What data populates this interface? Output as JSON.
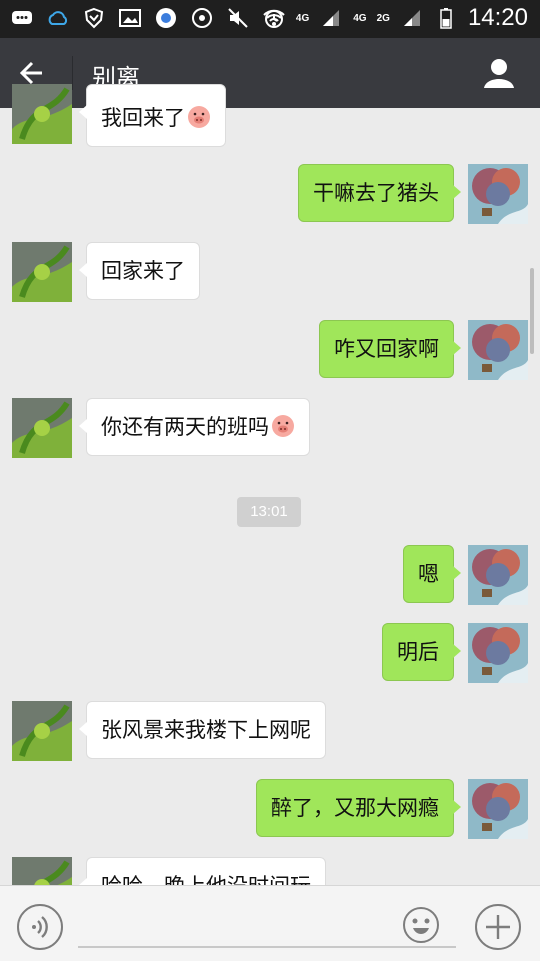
{
  "status_bar": {
    "time": "14:20",
    "network_1": "4G",
    "network_2": "4G",
    "network_3": "2G"
  },
  "header": {
    "title": "别离"
  },
  "messages": [
    {
      "side": "in",
      "text": "我回来了",
      "emoji": "pig-emoji"
    },
    {
      "side": "out",
      "text": "干嘛去了猪头"
    },
    {
      "side": "in",
      "text": "回家来了"
    },
    {
      "side": "out",
      "text": "咋又回家啊"
    },
    {
      "side": "in",
      "text": "你还有两天的班吗",
      "emoji": "pig-emoji"
    },
    {
      "side": "out",
      "text": "嗯"
    },
    {
      "side": "out",
      "text": "明后"
    },
    {
      "side": "in",
      "text": "张风景来我楼下上网呢"
    },
    {
      "side": "out",
      "text": "醉了，又那大网瘾"
    },
    {
      "side": "in",
      "text": "哈哈，晚上他没时间玩"
    }
  ],
  "timestamp": "13:01",
  "colors": {
    "outgoing_bubble": "#a0e65a",
    "incoming_bubble": "#ffffff",
    "header_bg": "#393a3f",
    "chat_bg": "#ebebeb"
  },
  "input_bar": {
    "icons": [
      "voice-icon",
      "emoji-icon",
      "plus-icon"
    ]
  }
}
